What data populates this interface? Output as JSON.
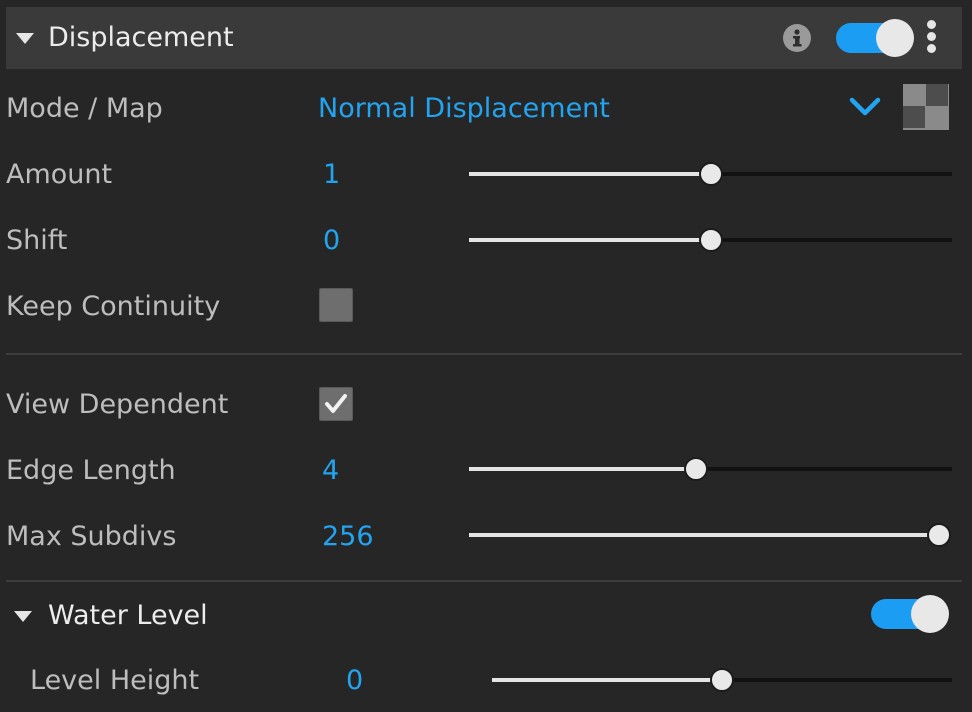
{
  "displacement": {
    "title": "Displacement",
    "enabled": true,
    "icons": [
      "info-icon",
      "kebab-menu-icon",
      "triangle-down-icon"
    ],
    "mode_label": "Mode / Map",
    "mode_value": "Normal Displacement",
    "amount": {
      "label": "Amount",
      "value": "1",
      "slider_fraction": 0.5
    },
    "shift": {
      "label": "Shift",
      "value": "0",
      "slider_fraction": 0.5
    },
    "keep_continuity": {
      "label": "Keep Continuity",
      "checked": false
    },
    "view_dependent": {
      "label": "View Dependent",
      "checked": true
    },
    "edge_length": {
      "label": "Edge Length",
      "value": "4",
      "slider_fraction": 0.47
    },
    "max_subdivs": {
      "label": "Max Subdivs",
      "value": "256",
      "slider_fraction": 1.0
    }
  },
  "water_level": {
    "title": "Water Level",
    "enabled": true,
    "level_height": {
      "label": "Level Height",
      "value": "0",
      "slider_fraction": 0.5
    }
  },
  "colors": {
    "accent": "#23a4f0",
    "toggle_on": "#1a9df2",
    "header_bg": "#3a3a3a",
    "panel_bg": "#262626"
  }
}
